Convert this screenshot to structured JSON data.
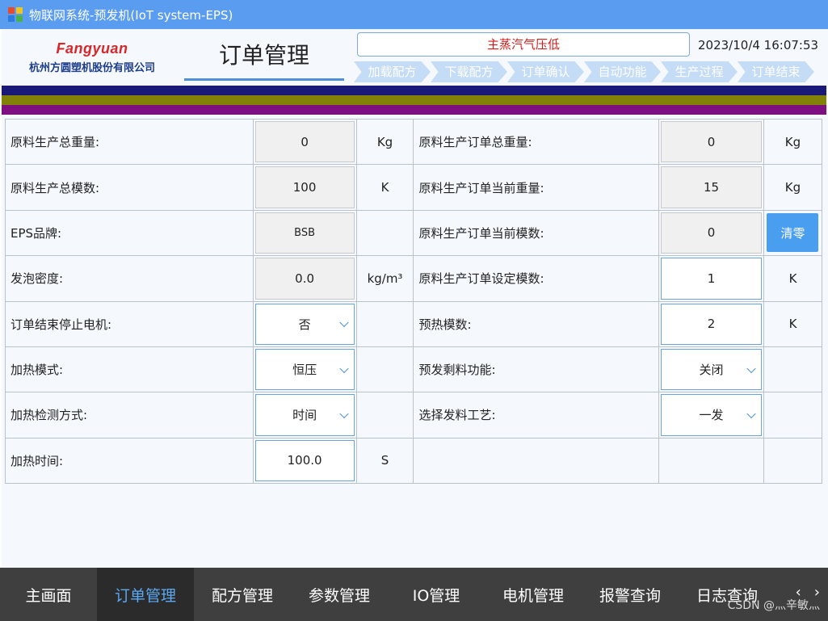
{
  "window": {
    "title": "物联网系统-预发机(IoT system-EPS)"
  },
  "brand": {
    "logo": "Fangyuan",
    "company": "杭州方圆塑机股份有限公司"
  },
  "page_title": "订单管理",
  "alarm": "主蒸汽气压低",
  "datetime": "2023/10/4 16:07:53",
  "steps": [
    "加载配方",
    "下载配方",
    "订单确认",
    "自动功能",
    "生产过程",
    "订单结束"
  ],
  "left_rows": [
    {
      "label": "原料生产总重量:",
      "value": "0",
      "unit": "Kg"
    },
    {
      "label": "原料生产总模数:",
      "value": "100",
      "unit": "K"
    },
    {
      "label": "EPS品牌:",
      "value": "BSB",
      "unit": ""
    },
    {
      "label": "发泡密度:",
      "value": "0.0",
      "unit": "kg/m³"
    },
    {
      "label": "订单结束停止电机:",
      "value": "否",
      "unit": ""
    },
    {
      "label": "加热模式:",
      "value": "恒压",
      "unit": ""
    },
    {
      "label": "加热检测方式:",
      "value": "时间",
      "unit": ""
    },
    {
      "label": "加热时间:",
      "value": "100.0",
      "unit": "S"
    }
  ],
  "right_rows": [
    {
      "label": "原料生产订单总重量:",
      "value": "0",
      "unit": "Kg"
    },
    {
      "label": "原料生产订单当前重量:",
      "value": "15",
      "unit": "Kg"
    },
    {
      "label": "原料生产订单当前模数:",
      "value": "0",
      "unit": ""
    },
    {
      "label": "原料生产订单设定模数:",
      "value": "1",
      "unit": "K"
    },
    {
      "label": "预热模数:",
      "value": "2",
      "unit": "K"
    },
    {
      "label": "预发剩料功能:",
      "value": "关闭",
      "unit": ""
    },
    {
      "label": "选择发料工艺:",
      "value": "一发",
      "unit": ""
    }
  ],
  "clear_button": "清零",
  "bottom_nav": [
    "主画面",
    "订单管理",
    "配方管理",
    "参数管理",
    "IO管理",
    "电机管理",
    "报警查询",
    "日志查询"
  ],
  "nav_arrows": {
    "prev": "‹",
    "next": "›"
  },
  "watermark": "CSDN @灬辛敏灬",
  "colors": {
    "titlebar": "#5a9cf0",
    "alarm_text": "#d11a1a",
    "active_nav": "#5aa9f2",
    "bar1": "#191a78",
    "bar2": "#828209",
    "bar3": "#7e0f80"
  }
}
